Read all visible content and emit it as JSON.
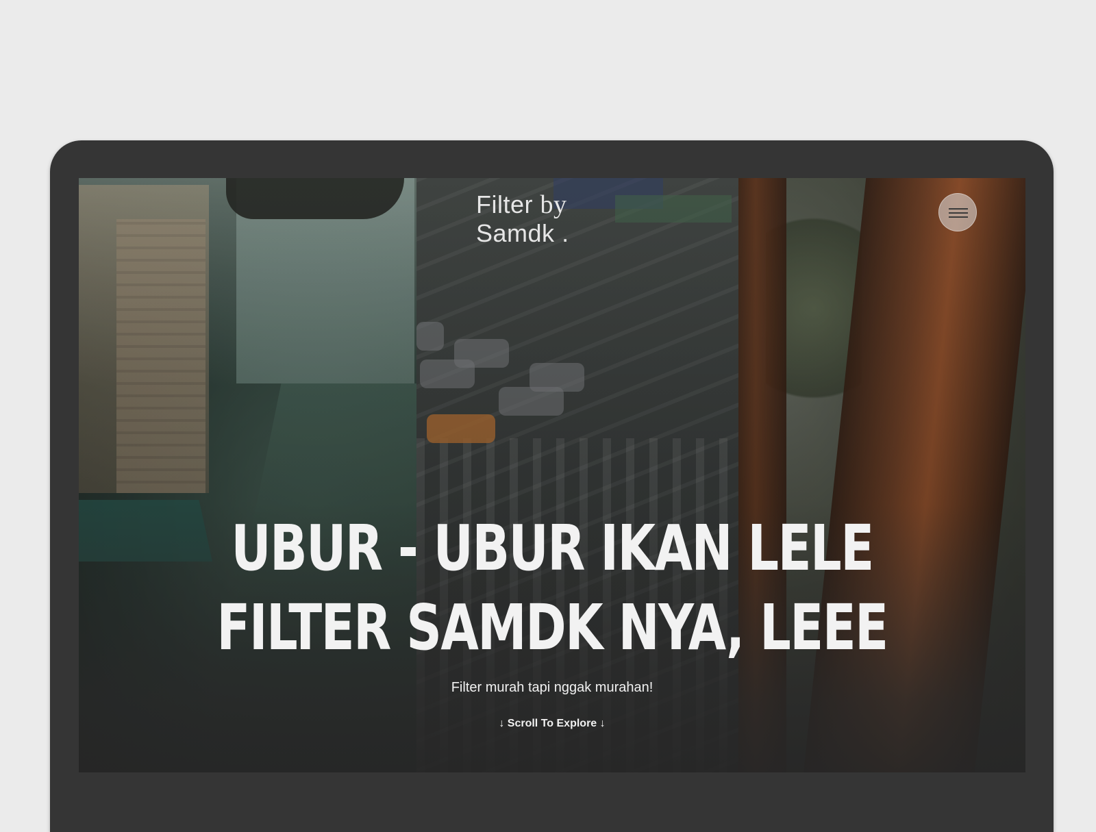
{
  "site": {
    "logo_line1": "Filter",
    "logo_by": "by",
    "logo_line2": "Samdk",
    "logo_dot": "."
  },
  "hero": {
    "headline_line1": "UBUR - UBUR IKAN LELE",
    "headline_line2": "FILTER SAMDK NYA, LEEE",
    "subtitle": "Filter murah tapi nggak murahan!",
    "scroll_cta": "↓ Scroll To Explore ↓"
  },
  "images": [
    {
      "name": "street-photo",
      "description_icon": "photo-icon"
    },
    {
      "name": "crosswalk-photo",
      "description_icon": "photo-icon"
    },
    {
      "name": "tree-trunk-photo",
      "description_icon": "photo-icon"
    }
  ],
  "menu": {
    "icon": "hamburger-menu-icon"
  },
  "colors": {
    "page_background": "#ebebeb",
    "device_frame": "#353535",
    "text_primary": "#f2f2f2"
  }
}
